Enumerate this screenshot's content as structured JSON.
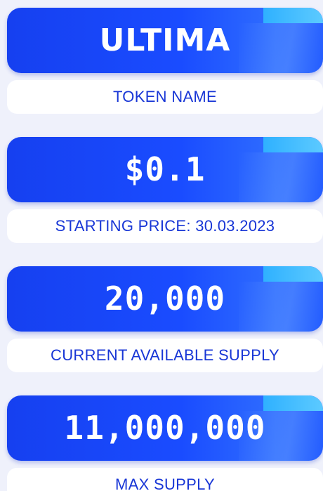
{
  "cards": [
    {
      "value": "ULTIMA",
      "label": "TOKEN NAME"
    },
    {
      "value": "$0.1",
      "label": "STARTING PRICE: 30.03.2023"
    },
    {
      "value": "20,000",
      "label": "CURRENT AVAILABLE SUPPLY"
    },
    {
      "value": "11,000,000",
      "label": "MAX SUPPLY"
    }
  ],
  "colors": {
    "page_background": "#eff1fb",
    "card_blue": "#1a4cff",
    "accent_cyan": "#3fc0ff",
    "label_text": "#1836d6",
    "label_background": "#ffffff"
  }
}
